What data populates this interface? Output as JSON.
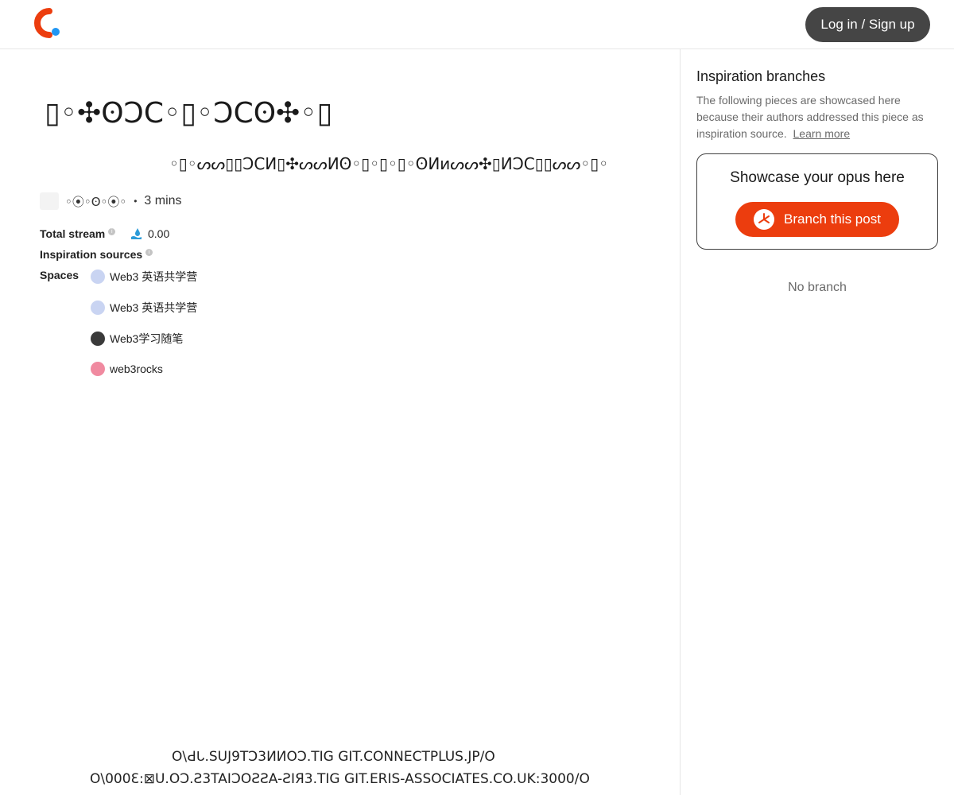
{
  "header": {
    "login_label": "Log in / Sign up"
  },
  "article": {
    "title": "▯◦✣ʘϽϹ◦▯◦ϽϹʘ✣◦▯",
    "subtitle": "◦▯◦ᔕᔕ▯▯ƆϹИ▯✣ᔕᔕИʘ◦▯◦▯◦▯◦ʘИᴎᔕᔕ✣▯ИƆϹ▯▯ᔕᔕ◦▯◦",
    "author": "◦⦿◦ʘ◦⦿◦",
    "read_time": "3 mins",
    "separator": "•"
  },
  "info": {
    "total_stream_label": "Total stream",
    "total_stream_value": "0.00",
    "inspiration_sources_label": "Inspiration sources",
    "spaces_label": "Spaces",
    "info_icon_glyph": "i"
  },
  "spaces": [
    {
      "name": "Web3 英语共学营",
      "avatar": "pale-blue",
      "color": "#c9d4f2"
    },
    {
      "name": "Web3 英语共学营",
      "avatar": "pale-blue",
      "color": "#c9d4f2"
    },
    {
      "name": "Web3学习随笔",
      "avatar": "dark-photo",
      "color": "#3a3a3a"
    },
    {
      "name": "web3rocks",
      "avatar": "pink",
      "color": "#f08aa0"
    }
  ],
  "footer": {
    "line1": "O\\Ԁᒐ.SUJ9TƆ3ИИOƆ.TIG GIT.CONNECTPLUS.JP/O",
    "line2": "O\\000Ɛ:⊠U.OƆ.Ƨ3TAIƆOƧƧA-ƧIЯ3.TIG GIT.ERIS-ASSOCIATES.CO.UK:3000/O"
  },
  "sidebar": {
    "title": "Inspiration branches",
    "description": "The following pieces are showcased here because their authors addressed this piece as inspiration source.",
    "learn_more": "Learn more",
    "card_title": "Showcase your opus here",
    "branch_button": "Branch this post",
    "empty_state": "No branch"
  },
  "colors": {
    "brand_red": "#ec3d0e",
    "brand_blue": "#2196f3",
    "button_dark": "#454545"
  }
}
